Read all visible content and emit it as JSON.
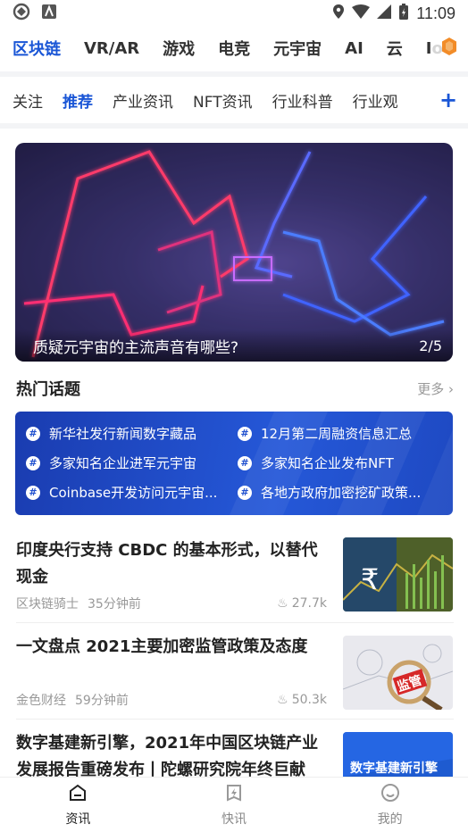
{
  "status_bar": {
    "time": "11:09"
  },
  "category_tabs": [
    {
      "label": "区块链",
      "active": true
    },
    {
      "label": "VR/AR",
      "active": false
    },
    {
      "label": "游戏",
      "active": false
    },
    {
      "label": "电竞",
      "active": false
    },
    {
      "label": "元宇宙",
      "active": false
    },
    {
      "label": "AI",
      "active": false
    },
    {
      "label": "云",
      "active": false
    },
    {
      "label": "Io",
      "active": false
    }
  ],
  "sub_tabs": [
    {
      "label": "关注",
      "active": false
    },
    {
      "label": "推荐",
      "active": true
    },
    {
      "label": "产业资讯",
      "active": false
    },
    {
      "label": "NFT资讯",
      "active": false
    },
    {
      "label": "行业科普",
      "active": false
    },
    {
      "label": "行业观",
      "active": false
    }
  ],
  "sub_tabs_add": "+",
  "banner": {
    "caption": "质疑元宇宙的主流声音有哪些?",
    "counter": "2/5"
  },
  "hot_topics": {
    "title": "热门话题",
    "more": "更多",
    "items": [
      "新华社发行新闻数字藏品",
      "12月第二周融资信息汇总",
      "多家知名企业进军元宇宙",
      "多家知名企业发布NFT",
      "Coinbase开发访问元宇宙...",
      "各地方政府加密挖矿政策..."
    ]
  },
  "articles": [
    {
      "title": "印度央行支持 CBDC 的基本形式，以替代现金",
      "source": "区块链骑士",
      "time": "35分钟前",
      "views": "27.7k",
      "thumb_text": "₹"
    },
    {
      "title": "一文盘点 2021主要加密监管政策及态度",
      "source": "金色财经",
      "time": "59分钟前",
      "views": "50.3k",
      "thumb_text": "监管"
    },
    {
      "title": "数字基建新引擎，2021年中国区块链产业发展报告重磅发布丨陀螺研究院年终巨献",
      "source": "",
      "time": "",
      "views": "",
      "thumb_text": "数字基建新引擎"
    }
  ],
  "bottom_nav": [
    {
      "label": "资讯",
      "icon": "home-icon",
      "active": true
    },
    {
      "label": "快讯",
      "icon": "flash-icon",
      "active": false
    },
    {
      "label": "我的",
      "icon": "profile-icon",
      "active": false
    }
  ],
  "colors": {
    "accent": "#1a56d6",
    "topics_bg": "#2558d8"
  }
}
